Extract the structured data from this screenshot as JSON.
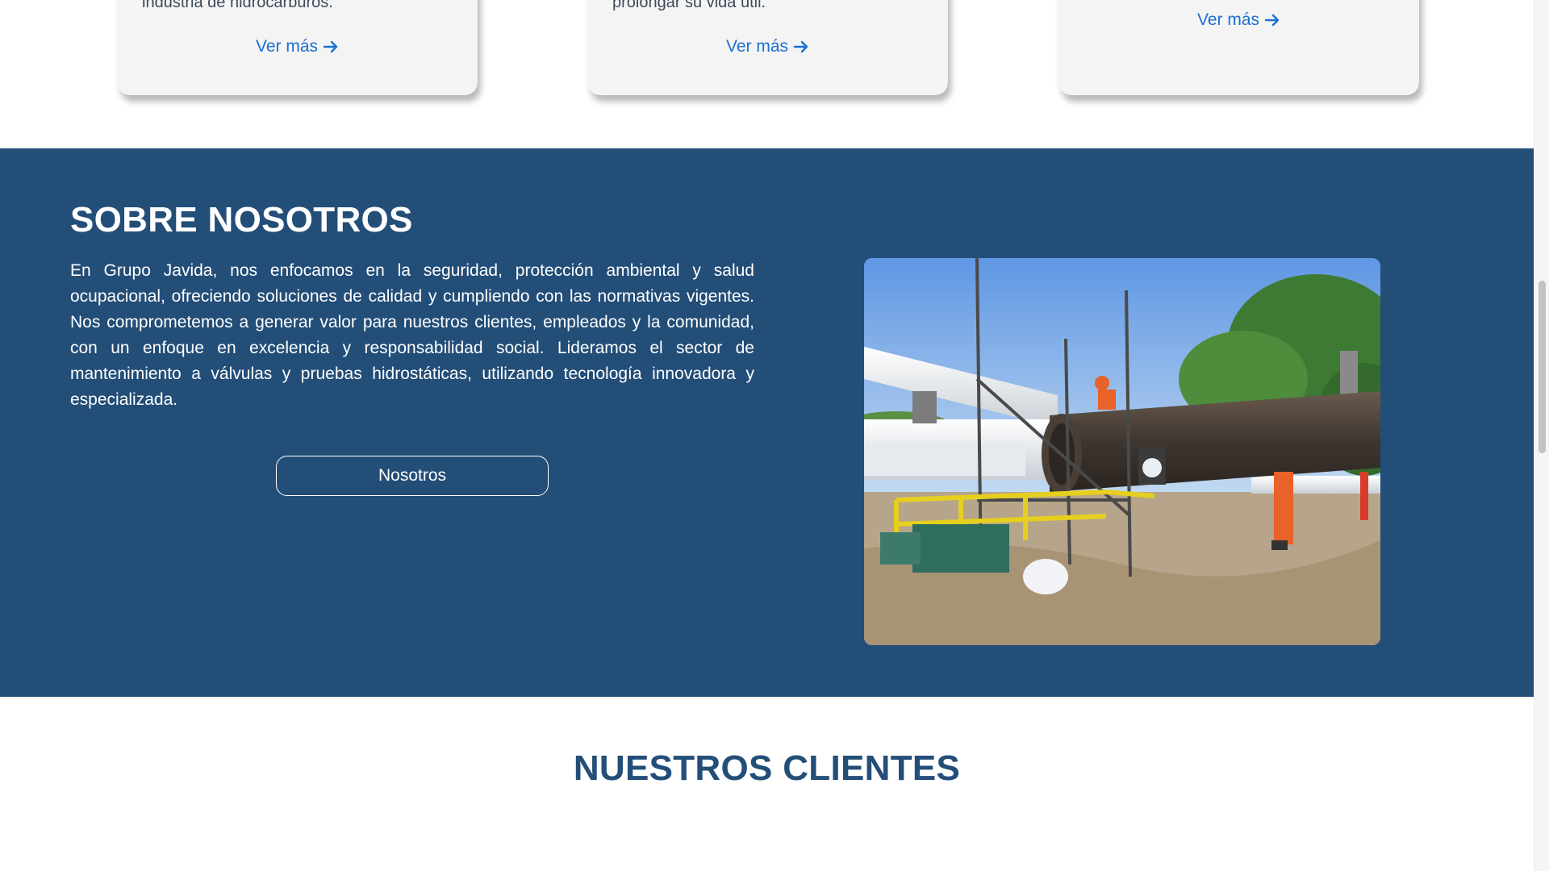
{
  "services": {
    "cards": [
      {
        "text": "industria de hidrocarburos.",
        "link": "Ver más"
      },
      {
        "text": "prolongar su vida útil.",
        "link": "Ver más"
      },
      {
        "text": "",
        "link": "Ver más"
      }
    ]
  },
  "about": {
    "title": "SOBRE NOSOTROS",
    "body": "En Grupo Javida, nos enfocamos en la seguridad, protección ambiental y salud ocupacional, ofreciendo soluciones de calidad y cumpliendo con las normativas vigentes. Nos comprometemos a generar valor para nuestros clientes, empleados y la comunidad, con un enfoque en excelencia y responsabilidad social. Lideramos el sector de mantenimiento a válvulas y pruebas hidrostáticas, utilizando tecnología innovadora y especializada.",
    "button_label": "Nosotros"
  },
  "clients": {
    "title": "NUESTROS CLIENTES"
  },
  "colors": {
    "section_bg": "#234e78",
    "link": "#1a6fd1",
    "card_bg": "#f4f4f4"
  },
  "icons": {
    "card_link_icon": "arrow-right-icon"
  }
}
